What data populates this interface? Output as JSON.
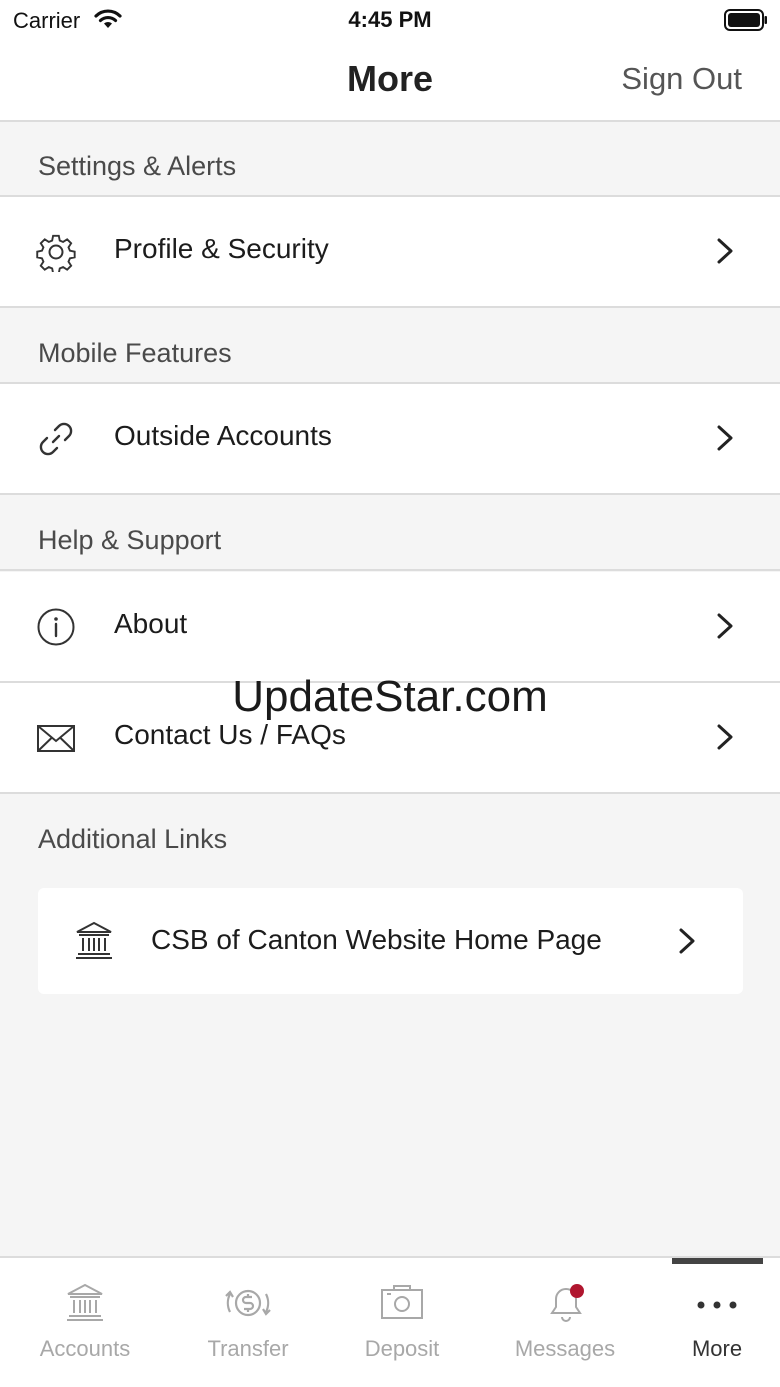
{
  "status_bar": {
    "carrier": "Carrier",
    "time": "4:45 PM"
  },
  "nav": {
    "title": "More",
    "sign_out": "Sign Out"
  },
  "sections": [
    {
      "header": "Settings & Alerts",
      "items": [
        {
          "label": "Profile & Security",
          "icon": "gear-icon"
        }
      ]
    },
    {
      "header": "Mobile Features",
      "items": [
        {
          "label": "Outside Accounts",
          "icon": "link-icon"
        }
      ]
    },
    {
      "header": "Help & Support",
      "items": [
        {
          "label": "About",
          "icon": "info-icon"
        },
        {
          "label": "Contact Us / FAQs",
          "icon": "envelope-icon"
        }
      ]
    },
    {
      "header": "Additional Links",
      "items": [
        {
          "label": "CSB of Canton Website Home Page",
          "icon": "bank-icon"
        }
      ]
    }
  ],
  "watermark": "UpdateStar.com",
  "tab_bar": {
    "tabs": [
      {
        "label": "Accounts",
        "icon": "bank-icon"
      },
      {
        "label": "Transfer",
        "icon": "transfer-dollar-icon"
      },
      {
        "label": "Deposit",
        "icon": "camera-icon"
      },
      {
        "label": "Messages",
        "icon": "bell-icon"
      },
      {
        "label": "More",
        "icon": "ellipsis-icon"
      }
    ],
    "active": "More"
  },
  "colors": {
    "accent_dark": "#444444",
    "notification_dot": "#b0162f",
    "inactive_tab": "#a8a8a8"
  }
}
